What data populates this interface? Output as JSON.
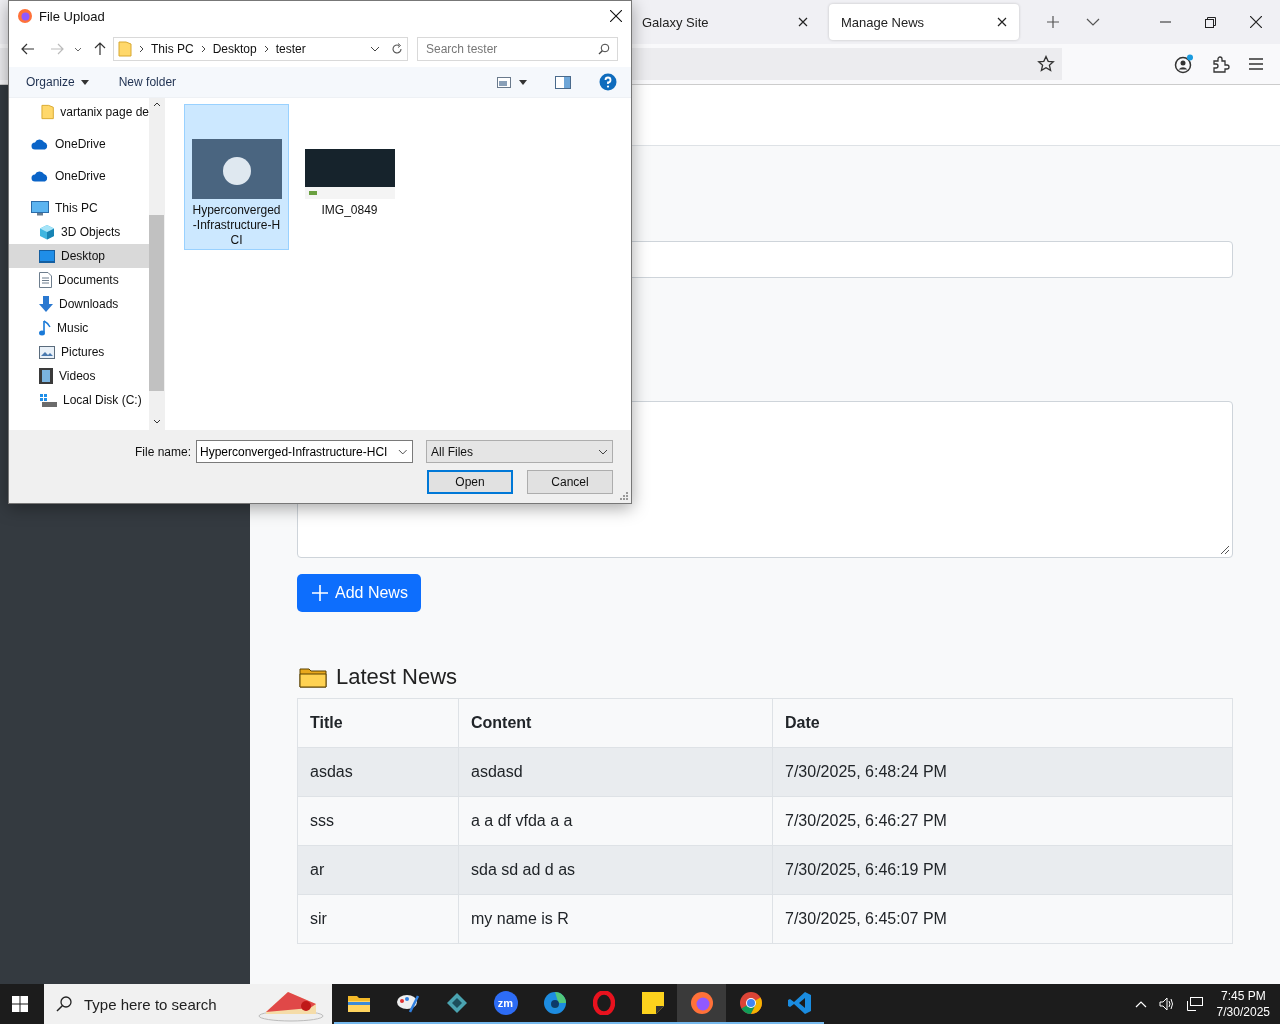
{
  "browser": {
    "tabs": [
      {
        "label": "Galaxy Site",
        "selected": false
      },
      {
        "label": "Manage News",
        "selected": true
      }
    ]
  },
  "page": {
    "add_button": "Add News",
    "section_title": "Latest News",
    "table": {
      "columns": [
        "Title",
        "Content",
        "Date"
      ],
      "rows": [
        [
          "asdas",
          "asdasd",
          "7/30/2025, 6:48:24 PM"
        ],
        [
          "sss",
          "a a df vfda a a",
          "7/30/2025, 6:46:27 PM"
        ],
        [
          "ar",
          "sda sd ad d as",
          "7/30/2025, 6:46:19 PM"
        ],
        [
          "sir",
          "my name is R",
          "7/30/2025, 6:45:07 PM"
        ]
      ]
    }
  },
  "dialog": {
    "title": "File Upload",
    "breadcrumb": [
      "This PC",
      "Desktop",
      "tester"
    ],
    "search": {
      "placeholder": "Search tester"
    },
    "toolbar": {
      "organize": "Organize",
      "new_folder": "New folder"
    },
    "nav": [
      {
        "label": "vartanix page de",
        "kind": "folder",
        "selected": false
      },
      {
        "label": "OneDrive",
        "kind": "cloud",
        "selected": false
      },
      {
        "label": "OneDrive",
        "kind": "cloud",
        "selected": false
      },
      {
        "label": "This PC",
        "kind": "pc",
        "selected": false,
        "children": [
          {
            "label": "3D Objects",
            "kind": "cube",
            "selected": false
          },
          {
            "label": "Desktop",
            "kind": "desktop",
            "selected": true
          },
          {
            "label": "Documents",
            "kind": "docs",
            "selected": false
          },
          {
            "label": "Downloads",
            "kind": "download",
            "selected": false
          },
          {
            "label": "Music",
            "kind": "music",
            "selected": false
          },
          {
            "label": "Pictures",
            "kind": "pictures",
            "selected": false
          },
          {
            "label": "Videos",
            "kind": "videos",
            "selected": false
          },
          {
            "label": "Local Disk (C:)",
            "kind": "disk",
            "selected": false
          }
        ]
      }
    ],
    "files": [
      {
        "lines": [
          "Hyperconverged",
          "-Infrastructure-H",
          "CI"
        ],
        "selected": true
      },
      {
        "lines": [
          "IMG_0849"
        ],
        "selected": false
      }
    ],
    "file_name_label": "File name:",
    "file_name": "Hyperconverged-Infrastructure-HCI",
    "filter": "All Files",
    "buttons": [
      {
        "label": "Open",
        "kind": "default"
      },
      {
        "label": "Cancel",
        "kind": "normal"
      }
    ]
  },
  "taskbar": {
    "search": {
      "placeholder": "Type here to search"
    },
    "apps": [
      {
        "kind": "explorer",
        "active": false
      },
      {
        "kind": "paint",
        "active": false
      },
      {
        "kind": "diamond",
        "active": false
      },
      {
        "kind": "zoom",
        "label": "zm",
        "active": false
      },
      {
        "kind": "edge",
        "active": false
      },
      {
        "kind": "opera",
        "active": false
      },
      {
        "kind": "notes",
        "active": false
      },
      {
        "kind": "firefox",
        "active": true
      },
      {
        "kind": "chrome",
        "active": false
      },
      {
        "kind": "vscode",
        "active": false
      }
    ],
    "time": "7:45 PM",
    "date": "7/30/2025"
  }
}
